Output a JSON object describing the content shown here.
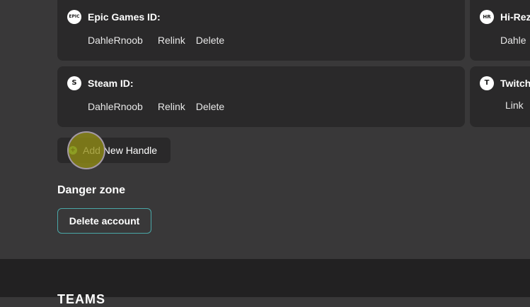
{
  "linked_accounts": [
    {
      "title": "Epic Games ID:",
      "icon": "epic-games-icon",
      "icon_text": "EPIC",
      "handle": "DahleRnoob",
      "actions": [
        "Relink",
        "Delete"
      ]
    },
    {
      "title": "Hi-Rez",
      "icon": "hi-rez-icon",
      "icon_text": "HR",
      "handle": "Dahle",
      "actions": []
    },
    {
      "title": "Steam ID:",
      "icon": "steam-icon",
      "icon_text": "S",
      "handle": "DahleRnoob",
      "actions": [
        "Relink",
        "Delete"
      ]
    },
    {
      "title": "Twitch",
      "icon": "twitch-icon",
      "icon_text": "T",
      "handle": "",
      "actions": [
        "Link"
      ]
    }
  ],
  "add_handle": {
    "label": "Add New Handle",
    "icon_glyph": "+",
    "icon": "plus-circle-icon"
  },
  "danger_zone": {
    "title": "Danger zone",
    "delete_label": "Delete account"
  },
  "footer": {
    "brand": "TEAMS"
  },
  "colors": {
    "page_background": "#393839",
    "card_background": "#2a292a",
    "footer_background": "#222122",
    "accent_green": "#7ed957",
    "accent_teal_border": "#4aa7a7"
  }
}
